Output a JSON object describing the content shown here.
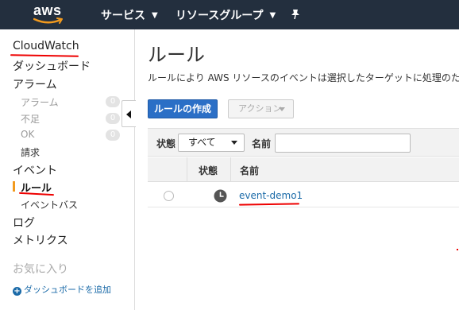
{
  "topnav": {
    "logo_text": "aws",
    "services_label": "サービス",
    "resource_groups_label": "リソースグループ",
    "pin_icon": "pin-icon"
  },
  "sidebar": {
    "cloudwatch": "CloudWatch",
    "dashboard": "ダッシュボード",
    "alarms": "アラーム",
    "alarm_sub": [
      {
        "label": "アラーム",
        "count": "0"
      },
      {
        "label": "不足",
        "count": "0"
      },
      {
        "label": "OK",
        "count": "0"
      }
    ],
    "billing": "請求",
    "events": "イベント",
    "rules": "ルール",
    "event_bus": "イベントバス",
    "logs": "ログ",
    "metrics": "メトリクス",
    "favorites": "お気に入り",
    "add_dashboard": "ダッシュボードを追加"
  },
  "main": {
    "title": "ルール",
    "description": "ルールにより AWS リソースのイベントは選択したターゲットに処理のた",
    "create_button": "ルールの作成",
    "actions_button": "アクション",
    "filter": {
      "status_label": "状態",
      "status_value": "すべて",
      "name_label": "名前",
      "name_value": ""
    },
    "table": {
      "headers": [
        "状態",
        "名前"
      ],
      "rows": [
        {
          "status_icon": "clock-icon",
          "name": "event-demo1"
        }
      ]
    }
  },
  "colors": {
    "nav_bg": "#232f3e",
    "primary_button": "#2b6fc6",
    "link": "#1a6aa8",
    "active_marker": "#f29a1e",
    "annotation_red": "#e00000"
  }
}
